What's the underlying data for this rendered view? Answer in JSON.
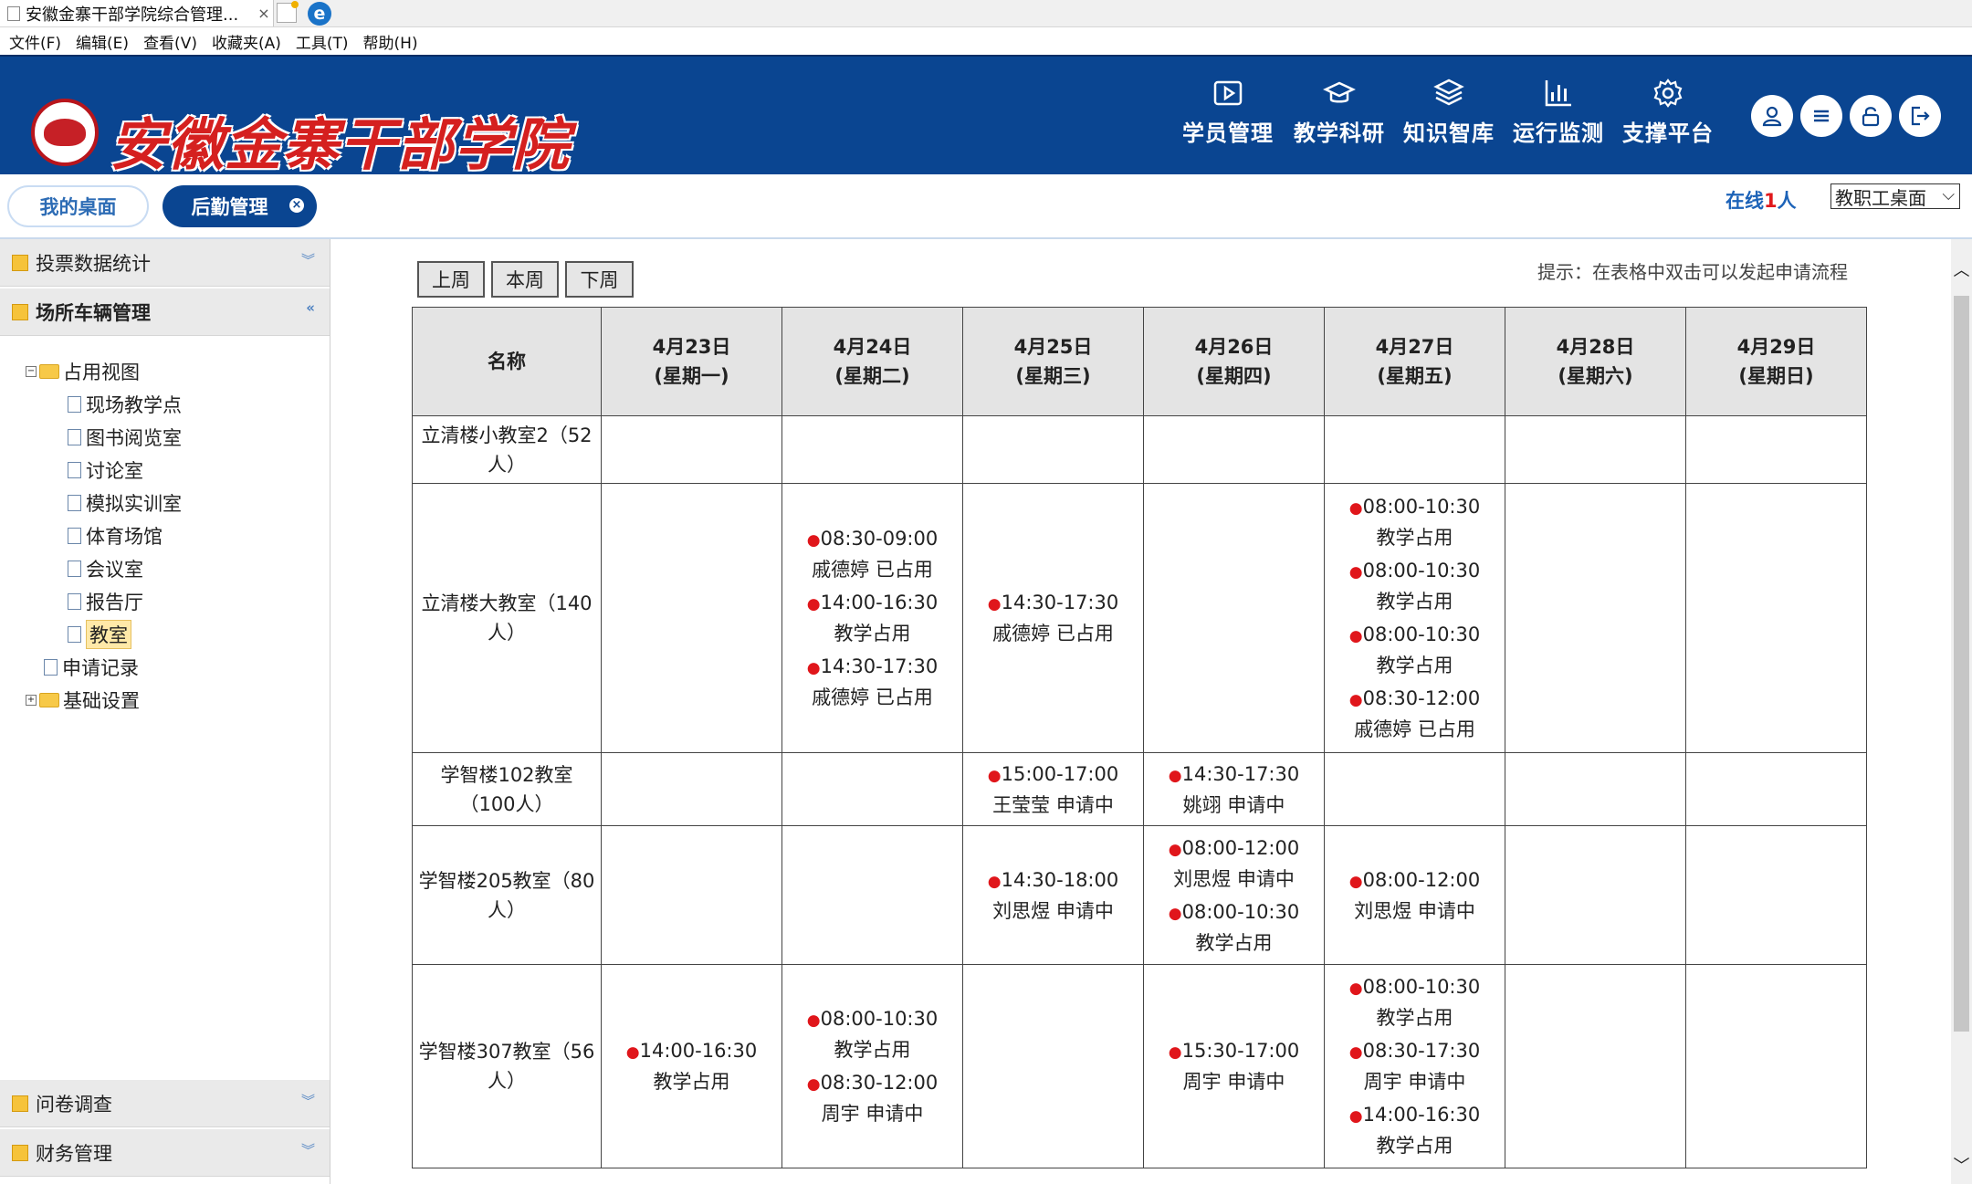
{
  "browser": {
    "tab_title": "安徽金寨干部学院综合管理...",
    "tab_close": "×",
    "ie_glyph": "e",
    "menu": [
      "文件(F)",
      "编辑(E)",
      "查看(V)",
      "收藏夹(A)",
      "工具(T)",
      "帮助(H)"
    ]
  },
  "header": {
    "brand": "安徽金寨干部学院",
    "nav": [
      "学员管理",
      "教学科研",
      "知识智库",
      "运行监测",
      "支撑平台"
    ],
    "right_buttons": [
      "user-icon",
      "menu-icon",
      "unlock-icon",
      "logout-icon"
    ],
    "colors": {
      "bar": "#0a4591",
      "brand_red": "#d5201f"
    }
  },
  "tabs": {
    "home": "我的桌面",
    "active": "后勤管理",
    "close": "×",
    "online_prefix": "在线",
    "online_count": "1",
    "online_suffix": "人",
    "desk_select": "教职工桌面"
  },
  "sidebar": {
    "sections_top": [
      "投票数据统计",
      "场所车辆管理"
    ],
    "tree": {
      "root": "占用视图",
      "children": [
        "现场教学点",
        "图书阅览室",
        "讨论室",
        "模拟实训室",
        "体育场馆",
        "会议室",
        "报告厅",
        "教室"
      ],
      "selected": "教室",
      "record": "申请记录",
      "settings": "基础设置"
    },
    "sections_bottom": [
      "问卷调查",
      "财务管理"
    ]
  },
  "main": {
    "buttons": [
      "上周",
      "本周",
      "下周"
    ],
    "hint": "提示：在表格中双击可以发起申请流程",
    "name_header": "名称",
    "days": [
      {
        "date": "4月23日",
        "week": "(星期一)"
      },
      {
        "date": "4月24日",
        "week": "(星期二)"
      },
      {
        "date": "4月25日",
        "week": "(星期三)"
      },
      {
        "date": "4月26日",
        "week": "(星期四)"
      },
      {
        "date": "4月27日",
        "week": "(星期五)"
      },
      {
        "date": "4月28日",
        "week": "(星期六)"
      },
      {
        "date": "4月29日",
        "week": "(星期日)"
      }
    ],
    "rooms": [
      {
        "name": "立清楼小教室2（52人）",
        "cells": [
          [],
          [],
          [],
          [],
          [],
          [],
          []
        ]
      },
      {
        "name": "立清楼大教室（140人）",
        "cells": [
          [],
          [
            {
              "time": "08:30-09:00",
              "who": "戚德婷 已占用"
            },
            {
              "time": "14:00-16:30",
              "who": "教学占用"
            },
            {
              "time": "14:30-17:30",
              "who": "戚德婷 已占用"
            }
          ],
          [
            {
              "time": "14:30-17:30",
              "who": "戚德婷 已占用"
            }
          ],
          [],
          [
            {
              "time": "08:00-10:30",
              "who": "教学占用"
            },
            {
              "time": "08:00-10:30",
              "who": "教学占用"
            },
            {
              "time": "08:00-10:30",
              "who": "教学占用"
            },
            {
              "time": "08:30-12:00",
              "who": "戚德婷 已占用"
            }
          ],
          [],
          []
        ]
      },
      {
        "name": "学智楼102教室（100人）",
        "cells": [
          [],
          [],
          [
            {
              "time": "15:00-17:00",
              "who": "王莹莹 申请中"
            }
          ],
          [
            {
              "time": "14:30-17:30",
              "who": "姚翊 申请中"
            }
          ],
          [],
          [],
          []
        ]
      },
      {
        "name": "学智楼205教室（80人）",
        "cells": [
          [],
          [],
          [
            {
              "time": "14:30-18:00",
              "who": "刘思煜 申请中"
            }
          ],
          [
            {
              "time": "08:00-12:00",
              "who": "刘思煜 申请中"
            },
            {
              "time": "08:00-10:30",
              "who": "教学占用"
            }
          ],
          [
            {
              "time": "08:00-12:00",
              "who": "刘思煜 申请中"
            }
          ],
          [],
          []
        ]
      },
      {
        "name": "学智楼307教室（56人）",
        "cells": [
          [
            {
              "time": "14:00-16:30",
              "who": "教学占用"
            }
          ],
          [
            {
              "time": "08:00-10:30",
              "who": "教学占用"
            },
            {
              "time": "08:30-12:00",
              "who": "周宇 申请中"
            }
          ],
          [],
          [
            {
              "time": "15:30-17:00",
              "who": "周宇 申请中"
            }
          ],
          [
            {
              "time": "08:00-10:30",
              "who": "教学占用"
            },
            {
              "time": "08:30-17:30",
              "who": "周宇 申请中"
            },
            {
              "time": "14:00-16:30",
              "who": "教学占用"
            }
          ],
          [],
          []
        ]
      }
    ],
    "dot_color": "#e0161b"
  }
}
